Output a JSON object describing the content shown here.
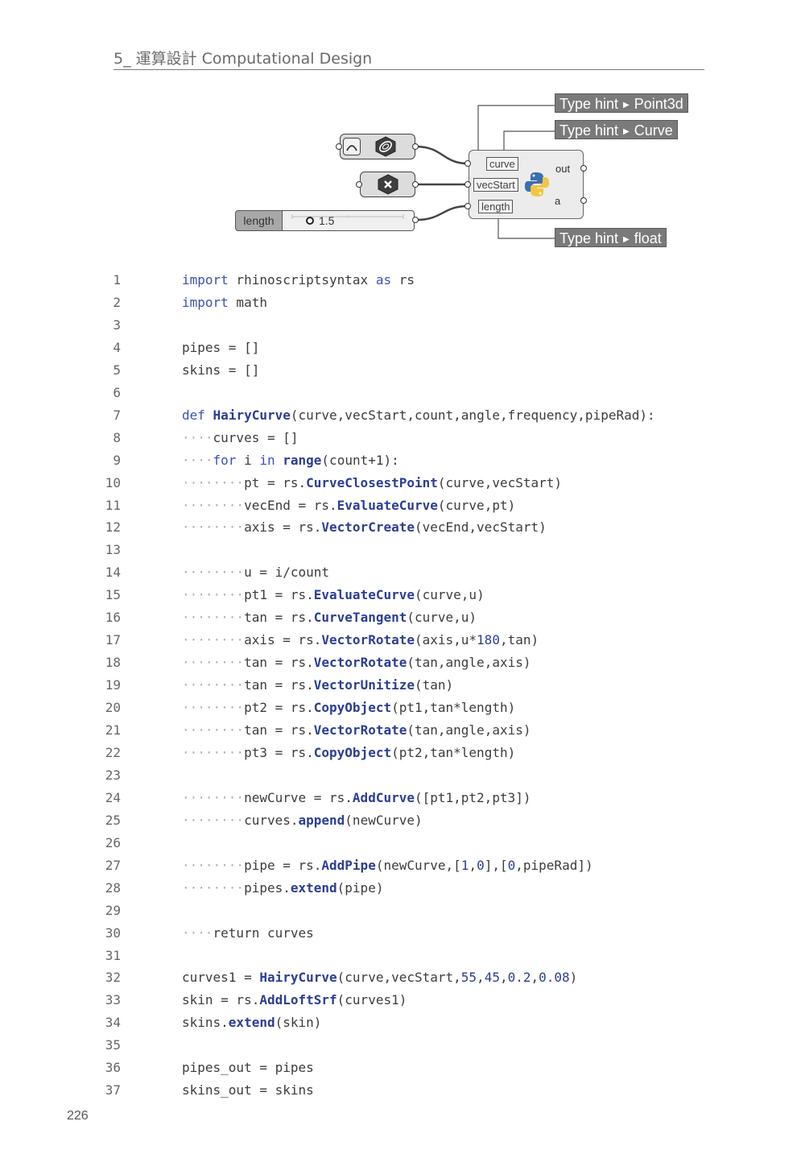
{
  "header": {
    "title": "5_ 運算設計 Computational Design"
  },
  "page_number": "226",
  "diagram": {
    "type_hints": [
      {
        "prefix": "Type hint",
        "value": "Point3d"
      },
      {
        "prefix": "Type hint",
        "value": "Curve"
      },
      {
        "prefix": "Type hint",
        "value": "float"
      }
    ],
    "python_component": {
      "inputs": [
        "curve",
        "vecStart",
        "length"
      ],
      "outputs": [
        "out",
        "a"
      ]
    },
    "slider": {
      "label": "length",
      "value": "1.5"
    },
    "icons": [
      "curve-param-icon",
      "point-param-icon",
      "python-icon"
    ]
  },
  "code": [
    {
      "n": "1",
      "t": [
        [
          "kw",
          "import"
        ],
        [
          "txt",
          " rhinoscriptsyntax "
        ],
        [
          "kw",
          "as"
        ],
        [
          "txt",
          " rs"
        ]
      ]
    },
    {
      "n": "2",
      "t": [
        [
          "kw",
          "import"
        ],
        [
          "txt",
          " math"
        ]
      ]
    },
    {
      "n": "3",
      "t": []
    },
    {
      "n": "4",
      "t": [
        [
          "txt",
          "pipes = []"
        ]
      ]
    },
    {
      "n": "5",
      "t": [
        [
          "txt",
          "skins = []"
        ]
      ]
    },
    {
      "n": "6",
      "t": []
    },
    {
      "n": "7",
      "t": [
        [
          "kw",
          "def"
        ],
        [
          "txt",
          " "
        ],
        [
          "fn",
          "HairyCurve"
        ],
        [
          "txt",
          "(curve,vecStart,count,angle,frequency,pipeRad):"
        ]
      ]
    },
    {
      "n": "8",
      "t": [
        [
          "ind",
          "····"
        ],
        [
          "txt",
          "curves = []"
        ]
      ]
    },
    {
      "n": "9",
      "t": [
        [
          "ind",
          "····"
        ],
        [
          "kw",
          "for"
        ],
        [
          "txt",
          " i "
        ],
        [
          "kw",
          "in"
        ],
        [
          "txt",
          " "
        ],
        [
          "fn",
          "range"
        ],
        [
          "txt",
          "(count+1):"
        ]
      ]
    },
    {
      "n": "10",
      "t": [
        [
          "ind",
          "········"
        ],
        [
          "txt",
          "pt = rs."
        ],
        [
          "fn",
          "CurveClosestPoint"
        ],
        [
          "txt",
          "(curve,vecStart)"
        ]
      ]
    },
    {
      "n": "11",
      "t": [
        [
          "ind",
          "········"
        ],
        [
          "txt",
          "vecEnd = rs."
        ],
        [
          "fn",
          "EvaluateCurve"
        ],
        [
          "txt",
          "(curve,pt)"
        ]
      ]
    },
    {
      "n": "12",
      "t": [
        [
          "ind",
          "········"
        ],
        [
          "txt",
          "axis = rs."
        ],
        [
          "fn",
          "VectorCreate"
        ],
        [
          "txt",
          "(vecEnd,vecStart)"
        ]
      ]
    },
    {
      "n": "13",
      "t": []
    },
    {
      "n": "14",
      "t": [
        [
          "ind",
          "········"
        ],
        [
          "txt",
          "u = i/count"
        ]
      ]
    },
    {
      "n": "15",
      "t": [
        [
          "ind",
          "········"
        ],
        [
          "txt",
          "pt1 = rs."
        ],
        [
          "fn",
          "EvaluateCurve"
        ],
        [
          "txt",
          "(curve,u)"
        ]
      ]
    },
    {
      "n": "16",
      "t": [
        [
          "ind",
          "········"
        ],
        [
          "txt",
          "tan = rs."
        ],
        [
          "fn",
          "CurveTangent"
        ],
        [
          "txt",
          "(curve,u)"
        ]
      ]
    },
    {
      "n": "17",
      "t": [
        [
          "ind",
          "········"
        ],
        [
          "txt",
          "axis = rs."
        ],
        [
          "fn",
          "VectorRotate"
        ],
        [
          "txt",
          "(axis,u*"
        ],
        [
          "num",
          "180"
        ],
        [
          "txt",
          ",tan)"
        ]
      ]
    },
    {
      "n": "18",
      "t": [
        [
          "ind",
          "········"
        ],
        [
          "txt",
          "tan = rs."
        ],
        [
          "fn",
          "VectorRotate"
        ],
        [
          "txt",
          "(tan,angle,axis)"
        ]
      ]
    },
    {
      "n": "19",
      "t": [
        [
          "ind",
          "········"
        ],
        [
          "txt",
          "tan = rs."
        ],
        [
          "fn",
          "VectorUnitize"
        ],
        [
          "txt",
          "(tan)"
        ]
      ]
    },
    {
      "n": "20",
      "t": [
        [
          "ind",
          "········"
        ],
        [
          "txt",
          "pt2 = rs."
        ],
        [
          "fn",
          "CopyObject"
        ],
        [
          "txt",
          "(pt1,tan*length)"
        ]
      ]
    },
    {
      "n": "21",
      "t": [
        [
          "ind",
          "········"
        ],
        [
          "txt",
          "tan = rs."
        ],
        [
          "fn",
          "VectorRotate"
        ],
        [
          "txt",
          "(tan,angle,axis)"
        ]
      ]
    },
    {
      "n": "22",
      "t": [
        [
          "ind",
          "········"
        ],
        [
          "txt",
          "pt3 = rs."
        ],
        [
          "fn",
          "CopyObject"
        ],
        [
          "txt",
          "(pt2,tan*length)"
        ]
      ]
    },
    {
      "n": "23",
      "t": []
    },
    {
      "n": "24",
      "t": [
        [
          "ind",
          "········"
        ],
        [
          "txt",
          "newCurve = rs."
        ],
        [
          "fn",
          "AddCurve"
        ],
        [
          "txt",
          "([pt1,pt2,pt3])"
        ]
      ]
    },
    {
      "n": "25",
      "t": [
        [
          "ind",
          "········"
        ],
        [
          "txt",
          "curves."
        ],
        [
          "fn",
          "append"
        ],
        [
          "txt",
          "(newCurve)"
        ]
      ]
    },
    {
      "n": "26",
      "t": []
    },
    {
      "n": "27",
      "t": [
        [
          "ind",
          "········"
        ],
        [
          "txt",
          "pipe = rs."
        ],
        [
          "fn",
          "AddPipe"
        ],
        [
          "txt",
          "(newCurve,["
        ],
        [
          "num",
          "1"
        ],
        [
          "txt",
          ","
        ],
        [
          "num",
          "0"
        ],
        [
          "txt",
          "],["
        ],
        [
          "num",
          "0"
        ],
        [
          "txt",
          ",pipeRad])"
        ]
      ]
    },
    {
      "n": "28",
      "t": [
        [
          "ind",
          "········"
        ],
        [
          "txt",
          "pipes."
        ],
        [
          "fn",
          "extend"
        ],
        [
          "txt",
          "(pipe)"
        ]
      ]
    },
    {
      "n": "29",
      "t": []
    },
    {
      "n": "30",
      "t": [
        [
          "ind",
          "····"
        ],
        [
          "txt",
          "return curves"
        ]
      ]
    },
    {
      "n": "31",
      "t": []
    },
    {
      "n": "32",
      "t": [
        [
          "txt",
          "curves1 = "
        ],
        [
          "fn",
          "HairyCurve"
        ],
        [
          "txt",
          "(curve,vecStart,"
        ],
        [
          "num",
          "55"
        ],
        [
          "txt",
          ","
        ],
        [
          "num",
          "45"
        ],
        [
          "txt",
          ","
        ],
        [
          "num",
          "0.2"
        ],
        [
          "txt",
          ","
        ],
        [
          "num",
          "0.08"
        ],
        [
          "txt",
          ")"
        ]
      ]
    },
    {
      "n": "33",
      "t": [
        [
          "txt",
          "skin = rs."
        ],
        [
          "fn",
          "AddLoftSrf"
        ],
        [
          "txt",
          "(curves1)"
        ]
      ]
    },
    {
      "n": "34",
      "t": [
        [
          "txt",
          "skins."
        ],
        [
          "fn",
          "extend"
        ],
        [
          "txt",
          "(skin)"
        ]
      ]
    },
    {
      "n": "35",
      "t": []
    },
    {
      "n": "36",
      "t": [
        [
          "txt",
          "pipes_out = pipes"
        ]
      ]
    },
    {
      "n": "37",
      "t": [
        [
          "txt",
          "skins_out = skins"
        ]
      ]
    }
  ]
}
